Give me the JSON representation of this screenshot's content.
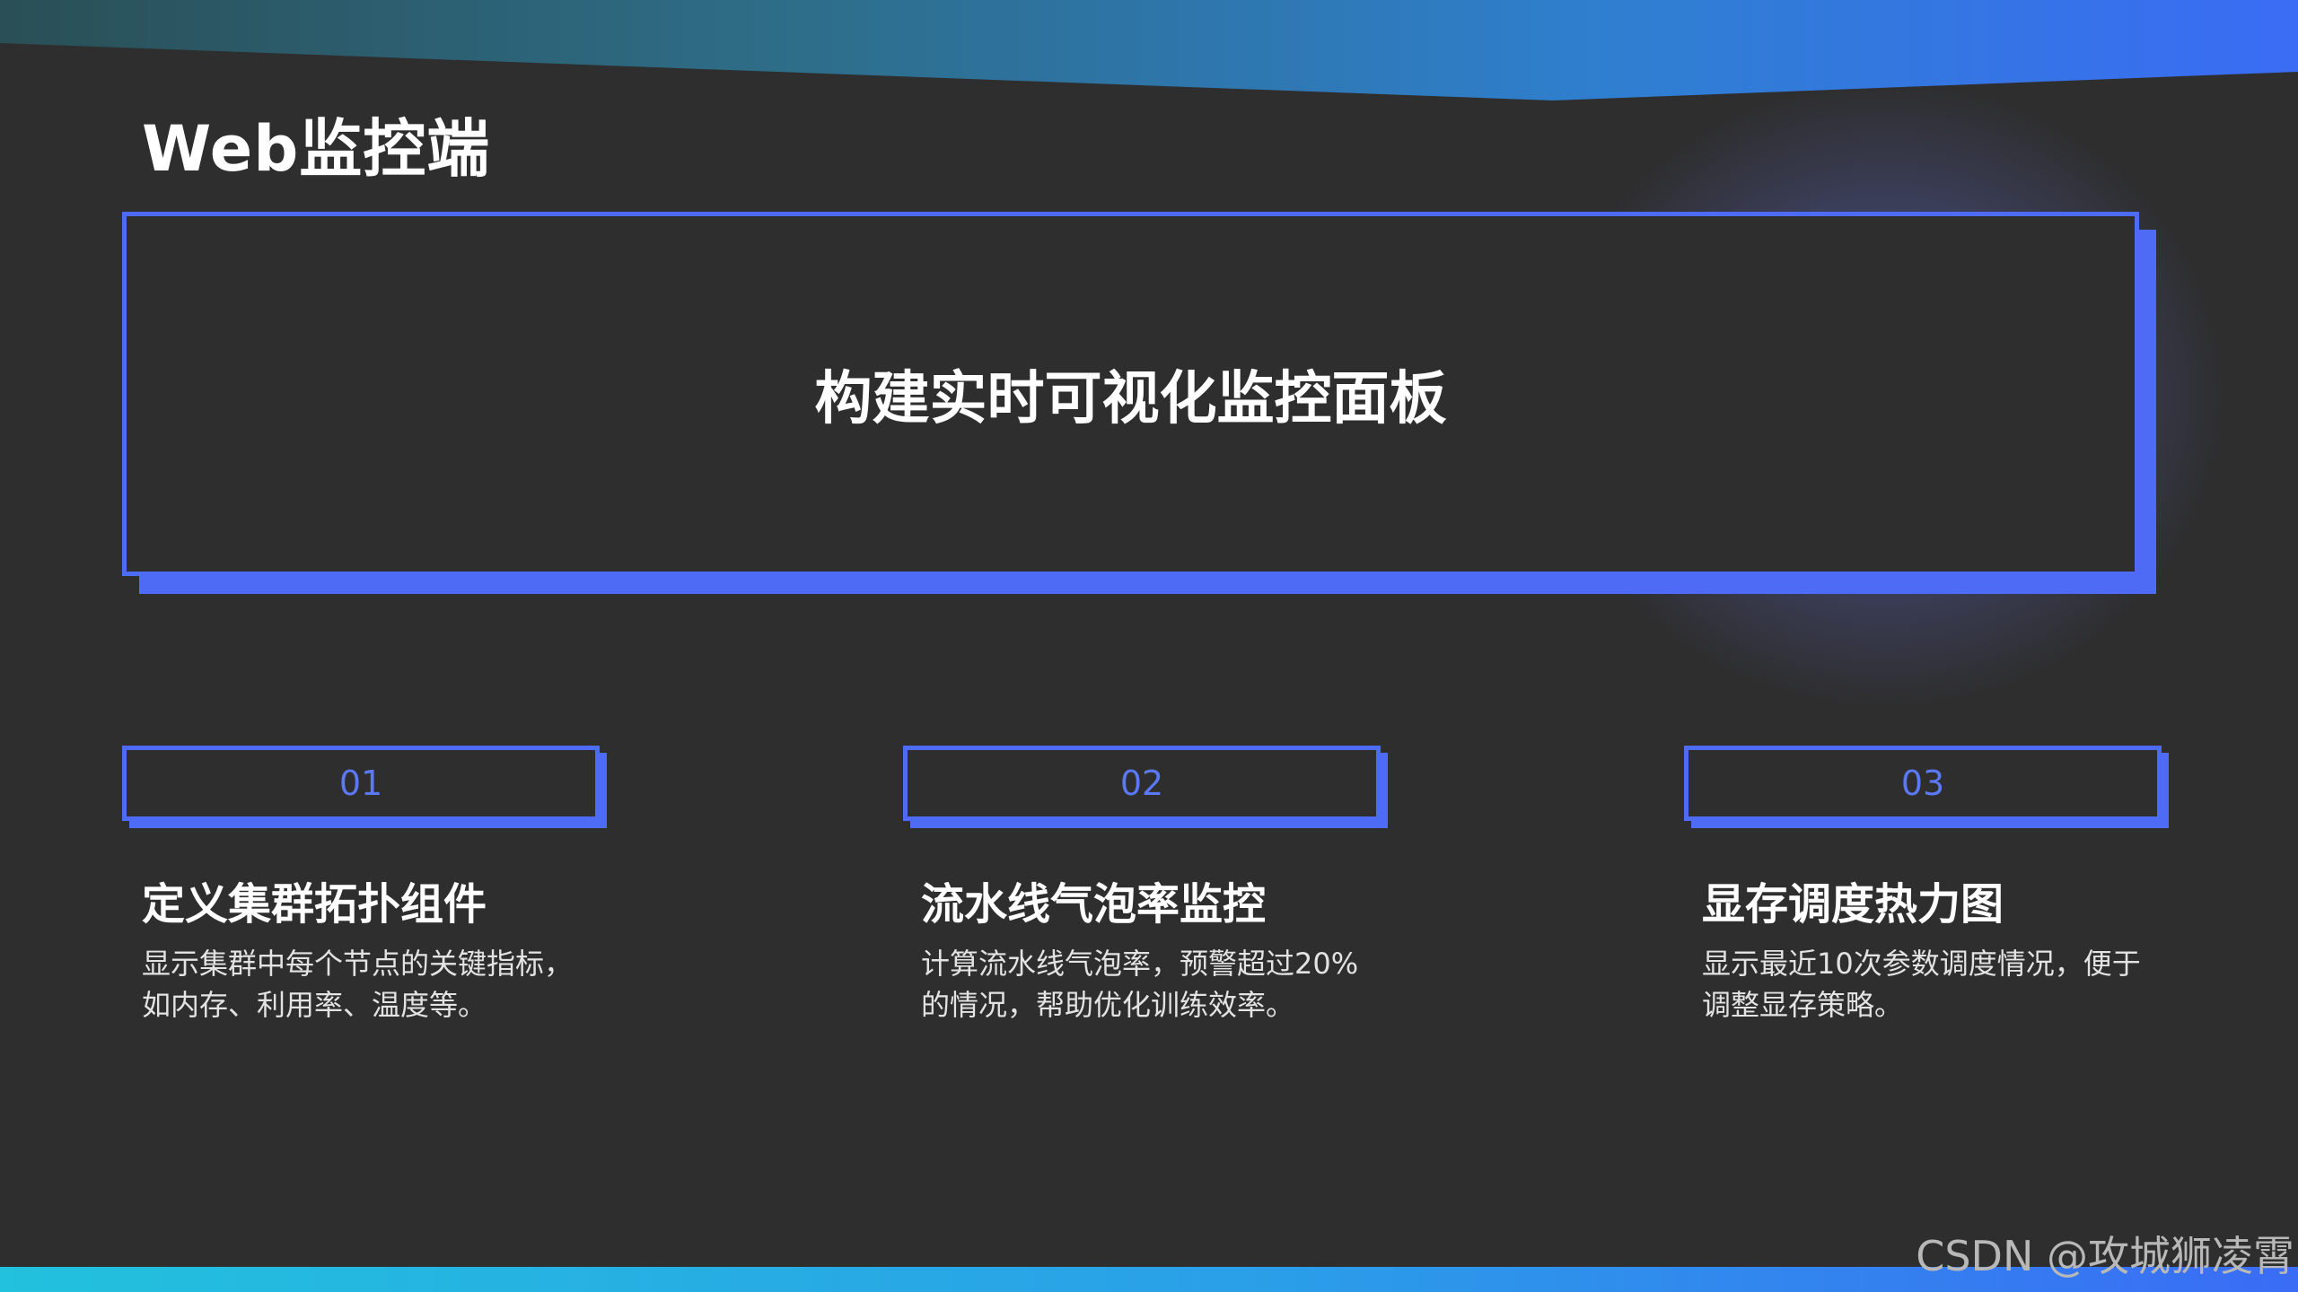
{
  "page": {
    "title": "Web监控端"
  },
  "hero": {
    "text": "构建实时可视化监控面板"
  },
  "cards": [
    {
      "number": "01",
      "title": "定义集群拓扑组件",
      "desc_line1": "显示集群中每个节点的关键指标，",
      "desc_line2": "如内存、利用率、温度等。"
    },
    {
      "number": "02",
      "title": "流水线气泡率监控",
      "desc_line1": "计算流水线气泡率，预警超过20%",
      "desc_line2": "的情况，帮助优化训练效率。"
    },
    {
      "number": "03",
      "title": "显存调度热力图",
      "desc_line1": "显示最近10次参数调度情况，便于",
      "desc_line2": "调整显存策略。"
    }
  ],
  "watermark": "CSDN @攻城狮凌霄",
  "colors": {
    "background": "#2e2e2e",
    "accent": "#4d6bf5",
    "number_text": "#5b78f6",
    "top_gradient_start": "#2a4f56",
    "top_gradient_end": "#3a6cf5",
    "bottom_gradient_start": "#22c1dd"
  }
}
